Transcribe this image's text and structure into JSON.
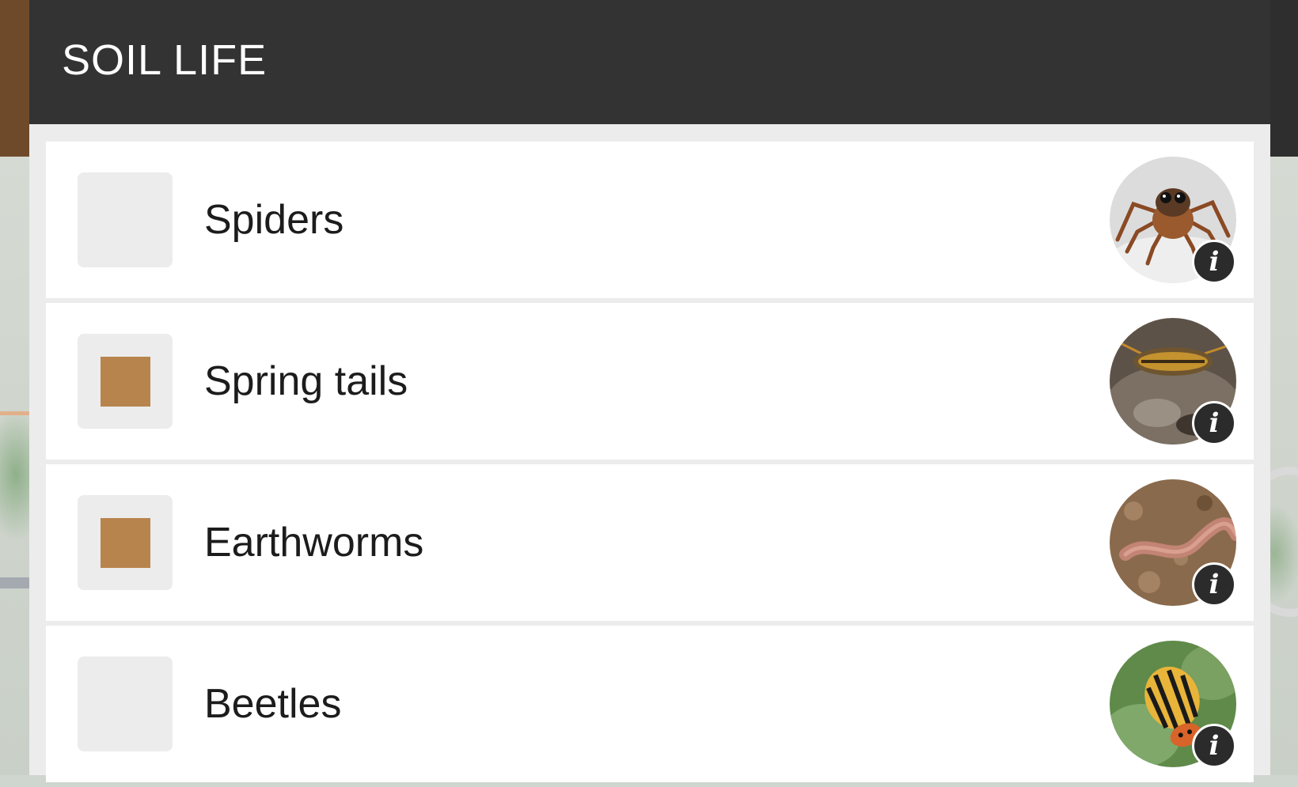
{
  "header": {
    "title": "SOIL LIFE"
  },
  "items": [
    {
      "label": "Spiders",
      "checked": false,
      "check_color": "#b8844d",
      "thumb_icon": "spider-photo-icon"
    },
    {
      "label": "Spring tails",
      "checked": true,
      "check_color": "#b8844d",
      "thumb_icon": "springtail-photo-icon"
    },
    {
      "label": "Earthworms",
      "checked": true,
      "check_color": "#b8844d",
      "thumb_icon": "earthworm-photo-icon"
    },
    {
      "label": "Beetles",
      "checked": false,
      "check_color": "#b8844d",
      "thumb_icon": "beetle-photo-icon"
    }
  ],
  "info_glyph": "i",
  "colors": {
    "header_bg": "#333333",
    "accent": "#b8844d",
    "modal_bg": "#ececec"
  }
}
